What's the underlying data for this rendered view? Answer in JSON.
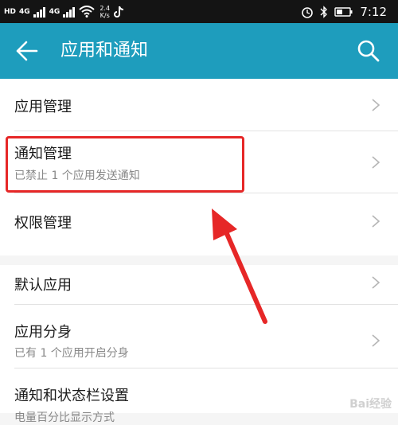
{
  "status_bar": {
    "hd_label": "HD",
    "net1": "4G",
    "net2": "4G",
    "speed_value": "2.4",
    "speed_unit": "K/s",
    "time": "7:12"
  },
  "header": {
    "title": "应用和通知",
    "back_icon": "back-arrow-icon",
    "search_icon": "search-icon"
  },
  "settings": {
    "group1": [
      {
        "title": "应用管理",
        "subtitle": ""
      },
      {
        "title": "通知管理",
        "subtitle": "已禁止 1 个应用发送通知"
      },
      {
        "title": "权限管理",
        "subtitle": ""
      }
    ],
    "group2": [
      {
        "title": "默认应用",
        "subtitle": ""
      },
      {
        "title": "应用分身",
        "subtitle": "已有 1 个应用开启分身"
      },
      {
        "title": "通知和状态栏设置",
        "subtitle": "电量百分比显示方式"
      }
    ]
  },
  "watermark": "Bai经验",
  "colors": {
    "header_bg": "#1e9dbd",
    "status_bg": "#141414",
    "highlight": "#e62727"
  }
}
